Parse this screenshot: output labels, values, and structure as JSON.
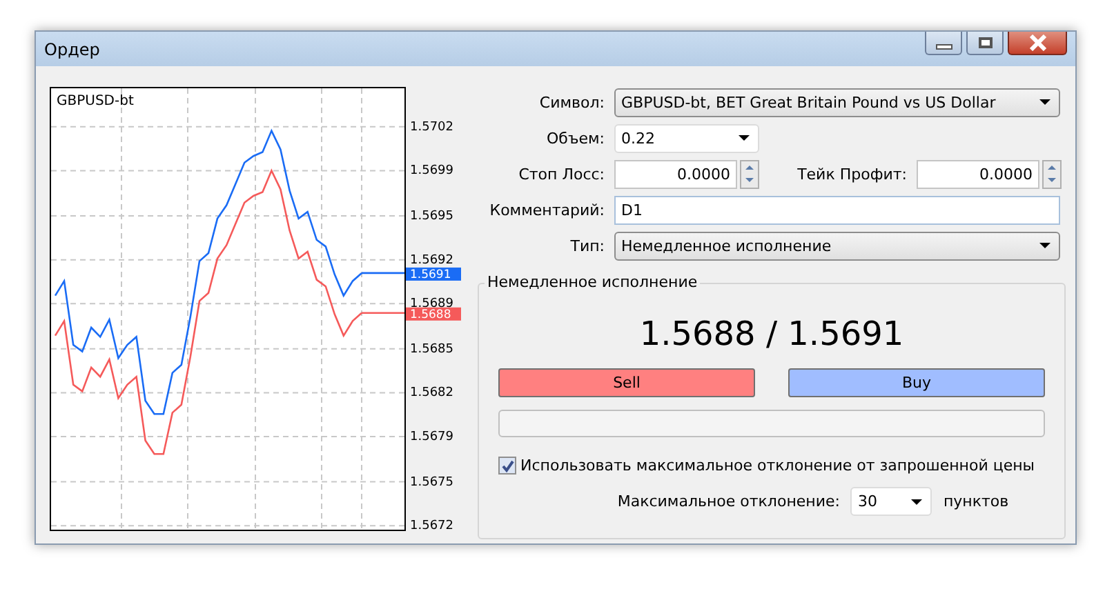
{
  "window": {
    "title": "Ордер"
  },
  "chart": {
    "chart_data": {
      "type": "line",
      "title": "GBPUSD-bt",
      "grid": true,
      "ylim": [
        1.56717,
        1.5705
      ],
      "yticks": [
        {
          "value": 1.5702,
          "label": "1.5702"
        },
        {
          "value": 1.56987,
          "label": "1.5699"
        },
        {
          "value": 1.56953,
          "label": "1.5695"
        },
        {
          "value": 1.5692,
          "label": "1.5692"
        },
        {
          "value": 1.56887,
          "label": "1.5689"
        },
        {
          "value": 1.56853,
          "label": "1.5685"
        },
        {
          "value": 1.5682,
          "label": "1.5682"
        },
        {
          "value": 1.56787,
          "label": "1.5679"
        },
        {
          "value": 1.56753,
          "label": "1.5675"
        },
        {
          "value": 1.5672,
          "label": "1.5672"
        }
      ],
      "series": [
        {
          "color": "#1a6cf5",
          "values": [
            1.56893,
            1.56904,
            1.56856,
            1.56851,
            1.56869,
            1.56862,
            1.56875,
            1.56846,
            1.56856,
            1.56862,
            1.56814,
            1.56804,
            1.56804,
            1.56835,
            1.56841,
            1.56877,
            1.56919,
            1.56925,
            1.56951,
            1.56961,
            1.56977,
            1.56993,
            1.56998,
            1.57001,
            1.57017,
            1.57003,
            1.56972,
            1.56951,
            1.56956,
            1.56935,
            1.5693,
            1.56909,
            1.56893,
            1.56904,
            1.5691
          ]
        },
        {
          "color": "#f55a5a",
          "values": [
            1.56863,
            1.56874,
            1.56826,
            1.56821,
            1.56839,
            1.56832,
            1.56845,
            1.56816,
            1.56826,
            1.56832,
            1.56784,
            1.56774,
            1.56774,
            1.56805,
            1.56811,
            1.56847,
            1.56889,
            1.56895,
            1.56921,
            1.56931,
            1.56947,
            1.56963,
            1.56968,
            1.56971,
            1.56987,
            1.56973,
            1.56942,
            1.56921,
            1.56926,
            1.56905,
            1.569,
            1.56879,
            1.56863,
            1.56874,
            1.5688
          ]
        }
      ]
    },
    "price_tags": [
      {
        "label": "1.5691",
        "color": "#1a6cf5"
      },
      {
        "label": "1.5688",
        "color": "#f55a5a"
      }
    ]
  },
  "form": {
    "symbol": {
      "label": "Символ:",
      "value": "GBPUSD-bt, BET Great Britain Pound vs US Dollar"
    },
    "volume": {
      "label": "Объем:",
      "value": "0.22"
    },
    "stop_loss": {
      "label": "Стоп Лосс:",
      "value": "0.0000"
    },
    "take_profit": {
      "label": "Тейк Профит:",
      "value": "0.0000"
    },
    "comment": {
      "label": "Комментарий:",
      "value": "D1"
    },
    "type": {
      "label": "Тип:",
      "value": "Немедленное исполнение"
    }
  },
  "execution": {
    "title": "Немедленное исполнение",
    "prices": "1.5688 / 1.5691",
    "sell": "Sell",
    "buy": "Buy",
    "use_deviation": {
      "label": "Использовать максимальное отклонение от запрошенной цены",
      "checked": true
    },
    "max_deviation": {
      "label": "Максимальное отклонение:",
      "value": "30",
      "unit": "пунктов"
    }
  }
}
